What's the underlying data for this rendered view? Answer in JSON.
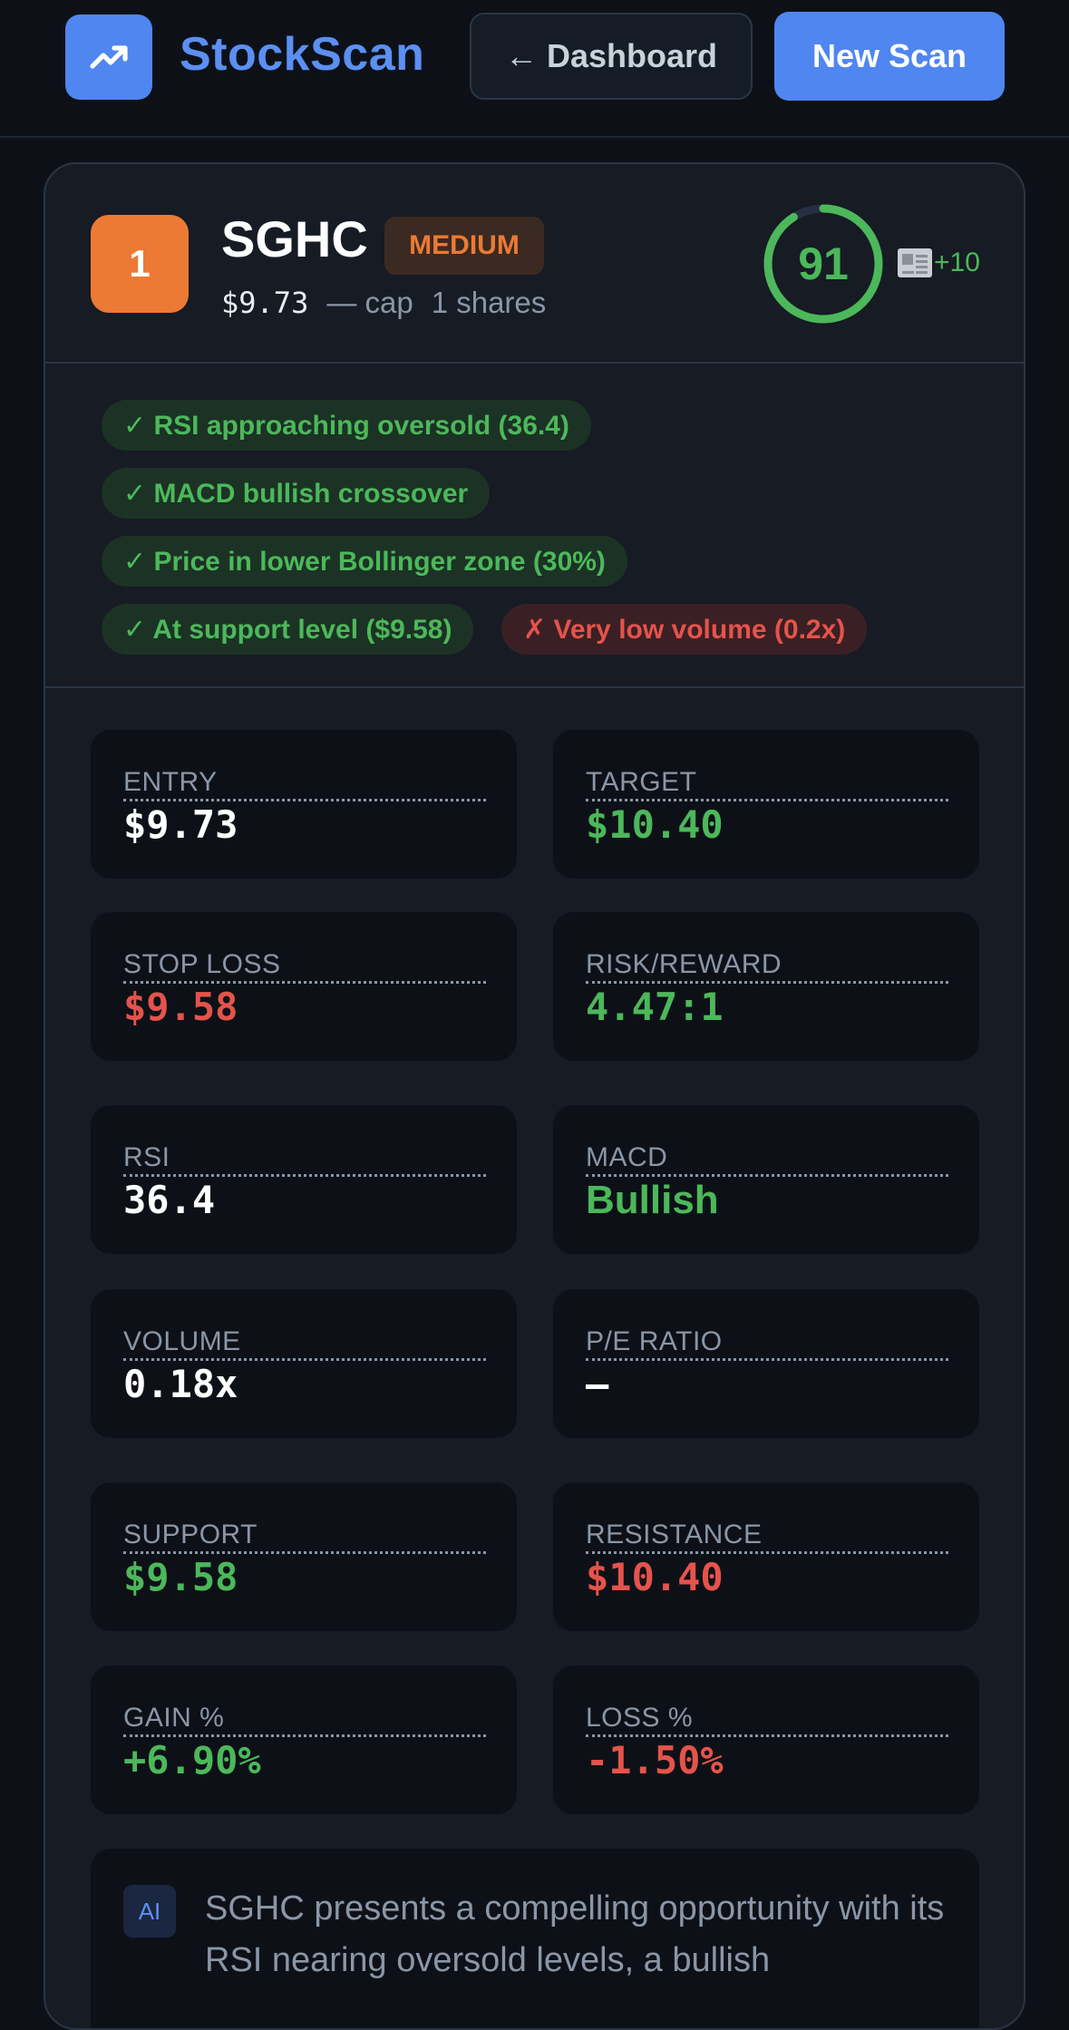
{
  "header": {
    "brand": "StockScan",
    "dashboard_label": "← Dashboard",
    "new_scan_label": "New Scan"
  },
  "stock": {
    "rank": "1",
    "ticker": "SGHC",
    "risk": "MEDIUM",
    "price": "$9.73",
    "cap_label": "— cap",
    "shares_label": "1 shares",
    "score": "91",
    "score_fraction": 0.91,
    "news_bonus": "+10"
  },
  "signals": [
    {
      "text": "✓ RSI approaching oversold (36.4)",
      "type": "good"
    },
    {
      "text": "✓ MACD bullish crossover",
      "type": "good"
    },
    {
      "text": "✓ Price in lower Bollinger zone (30%)",
      "type": "good"
    },
    {
      "text": "✓ At support level ($9.58)",
      "type": "good"
    },
    {
      "text": "✗ Very low volume (0.2x)",
      "type": "bad"
    }
  ],
  "stats": [
    {
      "label": "ENTRY",
      "value": "$9.73"
    },
    {
      "label": "TARGET",
      "value": "$10.40"
    },
    {
      "label": "STOP LOSS",
      "value": "$9.58"
    },
    {
      "label": "RISK/REWARD",
      "value": "4.47:1"
    },
    {
      "label": "RSI",
      "value": "36.4"
    },
    {
      "label": "MACD",
      "value": "Bullish"
    },
    {
      "label": "VOLUME",
      "value": "0.18x"
    },
    {
      "label": "P/E RATIO",
      "value": "—"
    },
    {
      "label": "SUPPORT",
      "value": "$9.58"
    },
    {
      "label": "RESISTANCE",
      "value": "$10.40"
    },
    {
      "label": "GAIN %",
      "value": "+6.90%"
    },
    {
      "label": "LOSS %",
      "value": "-1.50%"
    }
  ],
  "ai": {
    "badge": "AI",
    "text": "SGHC presents a compelling opportunity with its RSI nearing oversold levels, a bullish"
  },
  "colors": {
    "accent": "#4f86f0",
    "good": "#4cb85a",
    "bad": "#e5534b",
    "warning": "#ec7a34"
  }
}
